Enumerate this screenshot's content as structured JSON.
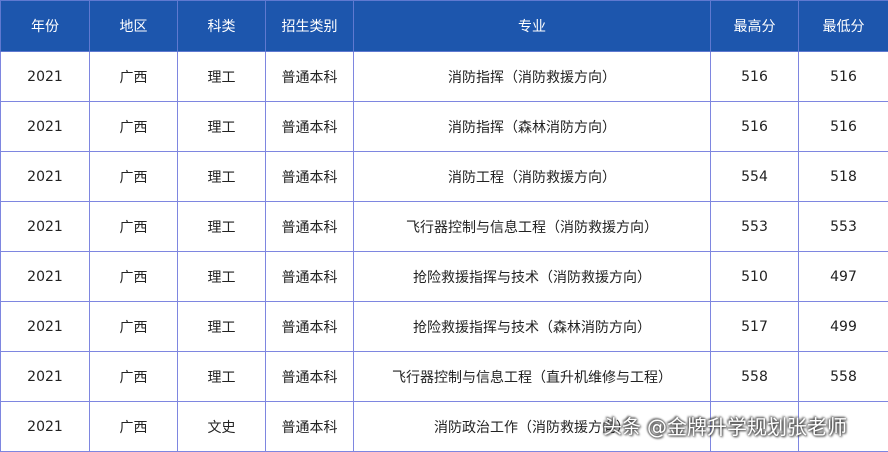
{
  "table": {
    "headers": [
      "年份",
      "地区",
      "科类",
      "招生类别",
      "专业",
      "最高分",
      "最低分"
    ],
    "rows": [
      [
        "2021",
        "广西",
        "理工",
        "普通本科",
        "消防指挥（消防救援方向）",
        "516",
        "516"
      ],
      [
        "2021",
        "广西",
        "理工",
        "普通本科",
        "消防指挥（森林消防方向）",
        "516",
        "516"
      ],
      [
        "2021",
        "广西",
        "理工",
        "普通本科",
        "消防工程（消防救援方向）",
        "554",
        "518"
      ],
      [
        "2021",
        "广西",
        "理工",
        "普通本科",
        "飞行器控制与信息工程（消防救援方向）",
        "553",
        "553"
      ],
      [
        "2021",
        "广西",
        "理工",
        "普通本科",
        "抢险救援指挥与技术（消防救援方向）",
        "510",
        "497"
      ],
      [
        "2021",
        "广西",
        "理工",
        "普通本科",
        "抢险救援指挥与技术（森林消防方向）",
        "517",
        "499"
      ],
      [
        "2021",
        "广西",
        "理工",
        "普通本科",
        "飞行器控制与信息工程（直升机维修与工程）",
        "558",
        "558"
      ],
      [
        "2021",
        "广西",
        "文史",
        "普通本科",
        "消防政治工作（消防救援方向）",
        "",
        ""
      ]
    ]
  },
  "watermark": {
    "platform": "头条",
    "author": "@金牌升学规划张老师"
  }
}
